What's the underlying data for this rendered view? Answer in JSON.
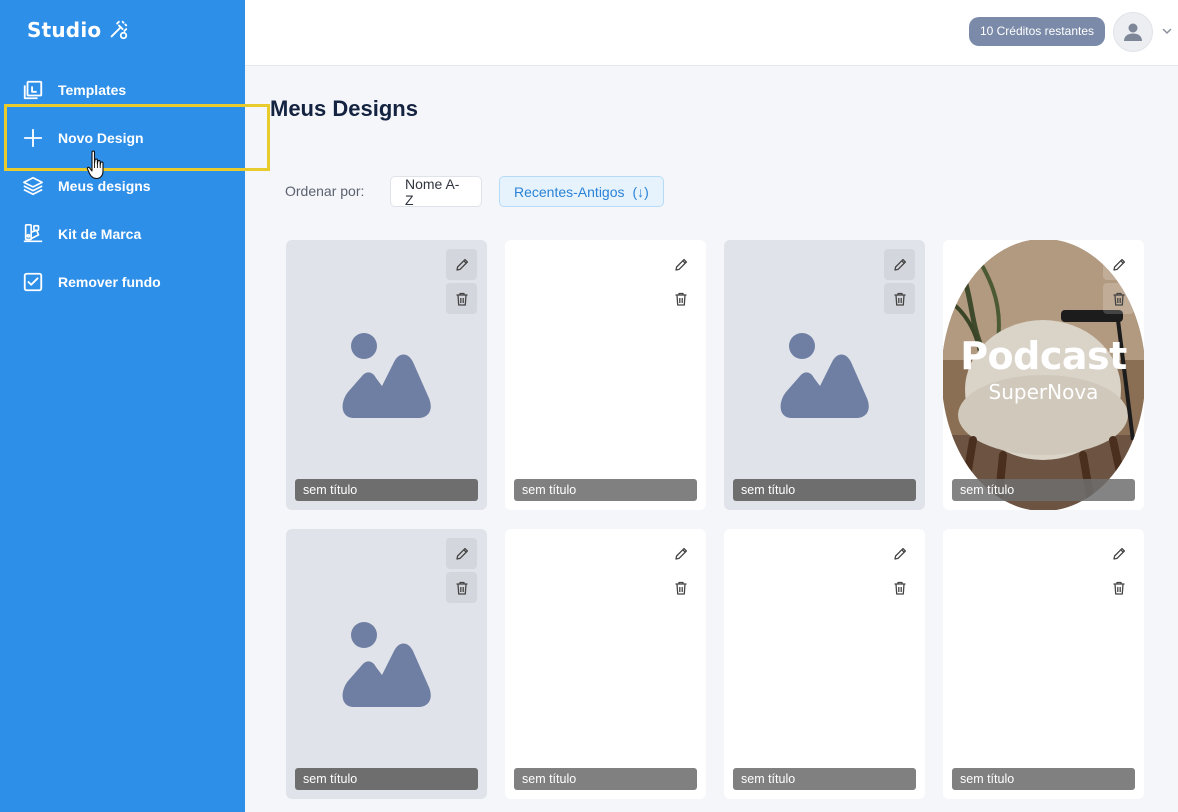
{
  "sidebar": {
    "brand": "Studio",
    "items": [
      {
        "label": "Templates",
        "icon": "templates-icon"
      },
      {
        "label": "Novo Design",
        "icon": "plus-icon"
      },
      {
        "label": "Meus designs",
        "icon": "layers-icon"
      },
      {
        "label": "Kit de Marca",
        "icon": "brand-kit-icon"
      },
      {
        "label": "Remover fundo",
        "icon": "remove-background-icon"
      }
    ]
  },
  "header": {
    "credits": "10 Créditos restantes"
  },
  "main": {
    "title": "Meus Designs",
    "sort": {
      "label": "Ordenar por:",
      "options": [
        "Nome A-Z",
        "Recentes-Antigos"
      ],
      "active_arrow": "(↓)"
    },
    "designs": [
      {
        "label": "sem título",
        "kind": "placeholder"
      },
      {
        "label": "sem título",
        "kind": "blank"
      },
      {
        "label": "sem título",
        "kind": "placeholder"
      },
      {
        "label": "sem título",
        "kind": "podcast",
        "art_title": "Podcast",
        "art_subtitle": "SuperNova"
      },
      {
        "label": "sem título",
        "kind": "placeholder"
      },
      {
        "label": "sem título",
        "kind": "blank"
      },
      {
        "label": "sem título",
        "kind": "blank"
      },
      {
        "label": "sem título",
        "kind": "blank"
      }
    ]
  },
  "colors": {
    "sidebar": "#2e8fe8",
    "highlight": "#e8cc2e",
    "accent": "#2b82d6",
    "placeholder_icon": "#6f7fa3"
  }
}
